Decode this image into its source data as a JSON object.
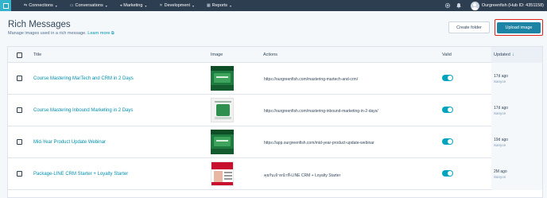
{
  "nav": {
    "items": [
      {
        "icon": "plug-icon",
        "glyph": "⇆",
        "label": "Connections"
      },
      {
        "icon": "chat-icon",
        "glyph": "💬",
        "label": "Conversations"
      },
      {
        "icon": "megaphone-icon",
        "glyph": "📣",
        "label": "Marketing"
      },
      {
        "icon": "tools-icon",
        "glyph": "⚒",
        "label": "Development"
      },
      {
        "icon": "chart-icon",
        "glyph": "⫶",
        "label": "Reports"
      }
    ],
    "account_name": "Ourgreenfish (Hub ID: 4351158)"
  },
  "header": {
    "title": "Rich Messages",
    "description": "Manage images used in a rich message.",
    "learn_more": "Learn more",
    "create_folder": "Create folder",
    "upload_image": "Upload image"
  },
  "table": {
    "columns": {
      "title": "Title",
      "image": "Image",
      "actions": "Actions",
      "valid": "Valid",
      "updated": "Updated"
    },
    "rows": [
      {
        "title": "Course Mastering MarTech and CRM in 2 Days",
        "url": "https://ourgreenfish.com/mastering-martech-and-crm/",
        "valid": true,
        "updated": "17d ago",
        "updated_by": "Sanyon",
        "thumb": "green"
      },
      {
        "title": "Course Mastering Inbound Marketing in 2 Days",
        "url": "https://ourgreenfish.com/mastering-inbound-marketing-in-2-days/",
        "valid": true,
        "updated": "17d ago",
        "updated_by": "Sanyon",
        "thumb": "white"
      },
      {
        "title": "Mid-Year Product Update Webinar",
        "url": "https://app.ourgreenfish.com/mid-year-product-update-webinar",
        "valid": true,
        "updated": "19d ago",
        "updated_by": "Sanyon",
        "thumb": "green"
      },
      {
        "title": "Package-LINE CRM Starter + Loyalty Starter",
        "url": "คุยกับเจ้าหน้าที่-LINE CRM + Loyalty Starter",
        "valid": true,
        "updated": "2M ago",
        "updated_by": "Sanyon",
        "thumb": "red"
      }
    ]
  }
}
